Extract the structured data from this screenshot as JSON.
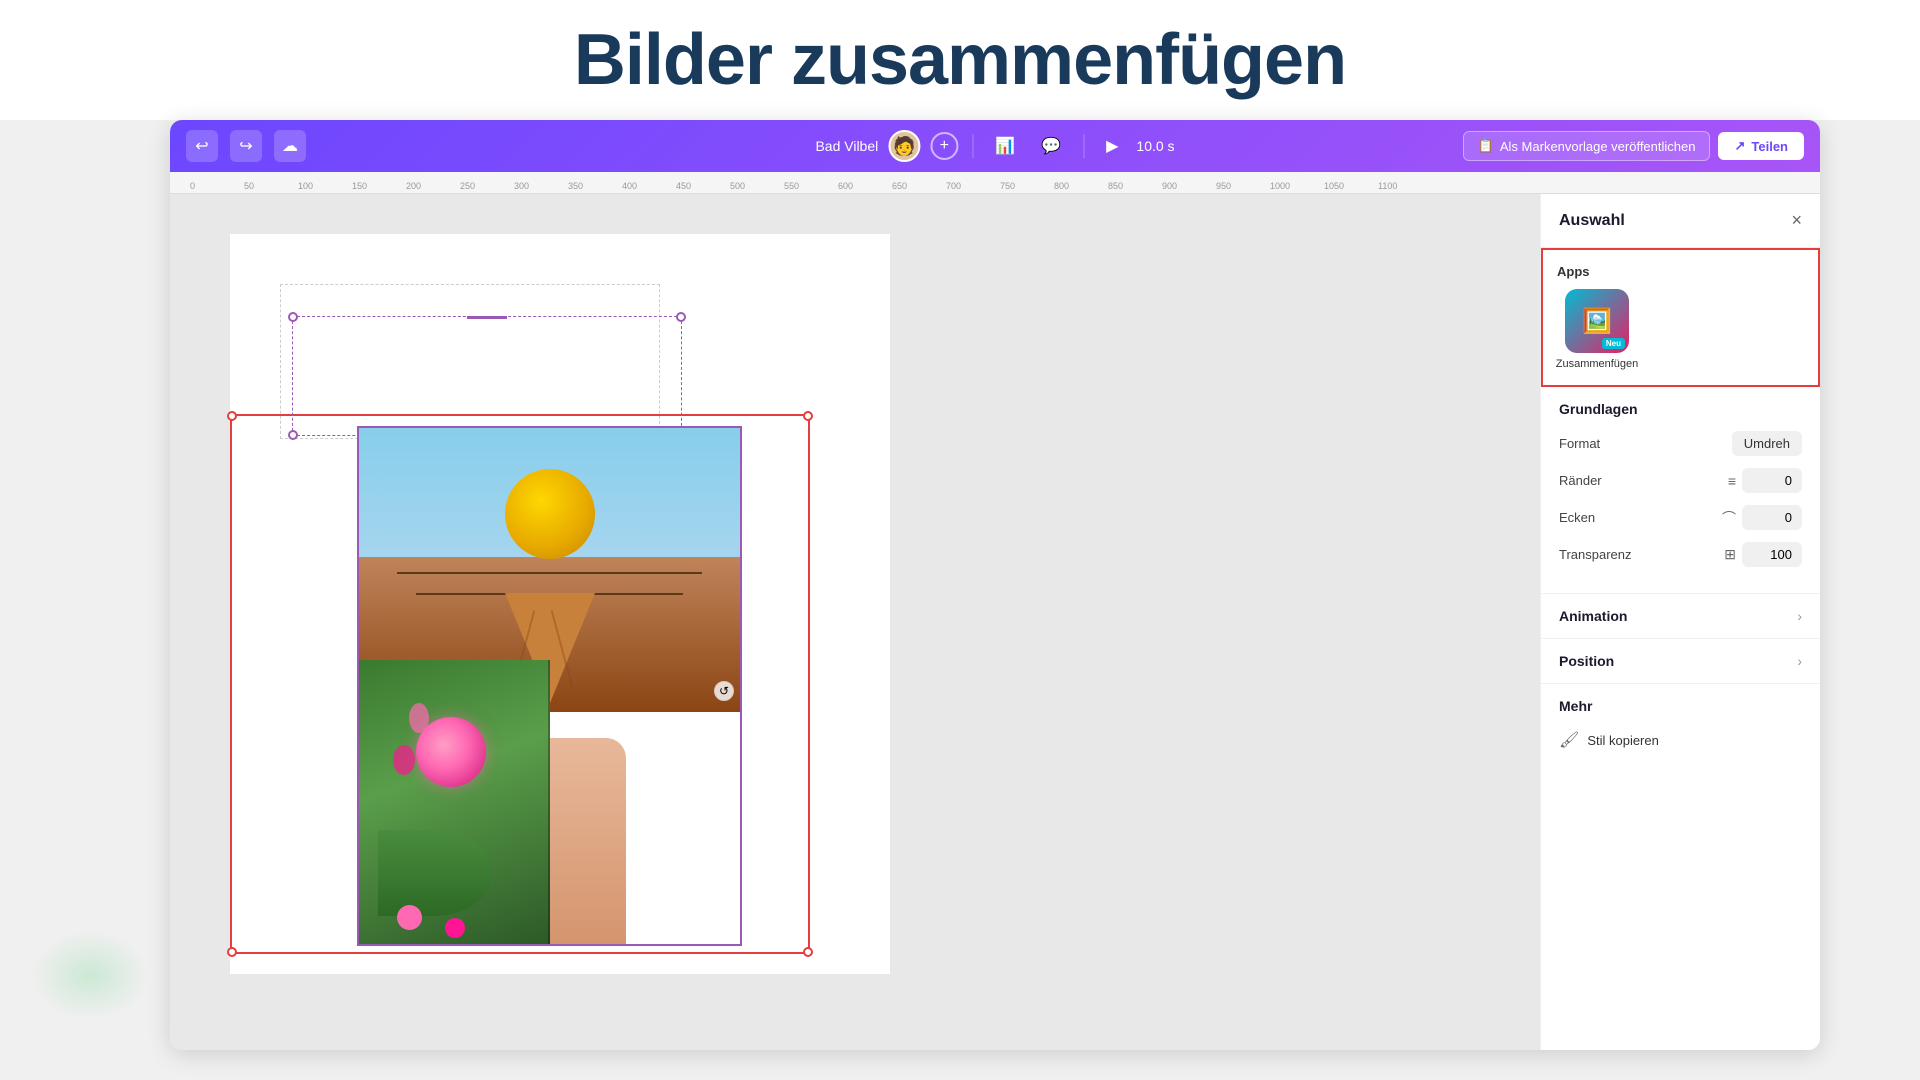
{
  "page": {
    "title": "Bilder zusammenfügen",
    "background": "white"
  },
  "toolbar": {
    "undo_label": "↩",
    "redo_label": "↪",
    "cloud_label": "☁",
    "location": "Bad Vilbel",
    "plus_label": "+",
    "chart_label": "📊",
    "comment_label": "💬",
    "play_label": "▶",
    "time": "10.0 s",
    "publish_label": "Als Markenvorlage veröffentlichen",
    "share_label": "Teilen",
    "share_icon": "↗"
  },
  "ruler": {
    "marks": [
      "0",
      "50",
      "100",
      "150",
      "200",
      "250",
      "300",
      "350",
      "400",
      "450",
      "500",
      "550",
      "600",
      "650",
      "700",
      "750",
      "800",
      "850",
      "900",
      "950",
      "1000",
      "1050",
      "1100"
    ]
  },
  "right_panel": {
    "title": "Auswahl",
    "close_label": "×",
    "apps_section": {
      "label": "Apps",
      "app": {
        "name": "Zusammenfügen",
        "badge": "Neu"
      }
    },
    "grundlagen": {
      "title": "Grundlagen",
      "format": {
        "label": "Format",
        "value": "Umdreh"
      },
      "raender": {
        "label": "Ränder",
        "icon": "≡",
        "value": "0"
      },
      "ecken": {
        "label": "Ecken",
        "icon": "⌒",
        "value": "0"
      },
      "transparenz": {
        "label": "Transparenz",
        "icon": "⊞",
        "value": "100"
      }
    },
    "animation": {
      "title": "Animation",
      "chevron": "›"
    },
    "position": {
      "title": "Position",
      "chevron": "›"
    },
    "mehr": {
      "title": "Mehr",
      "stil_kopieren_label": "Stil kopieren",
      "stil_icon": "🖌"
    }
  },
  "deco": {
    "slash1": "",
    "slash2": "",
    "slash3": ""
  }
}
